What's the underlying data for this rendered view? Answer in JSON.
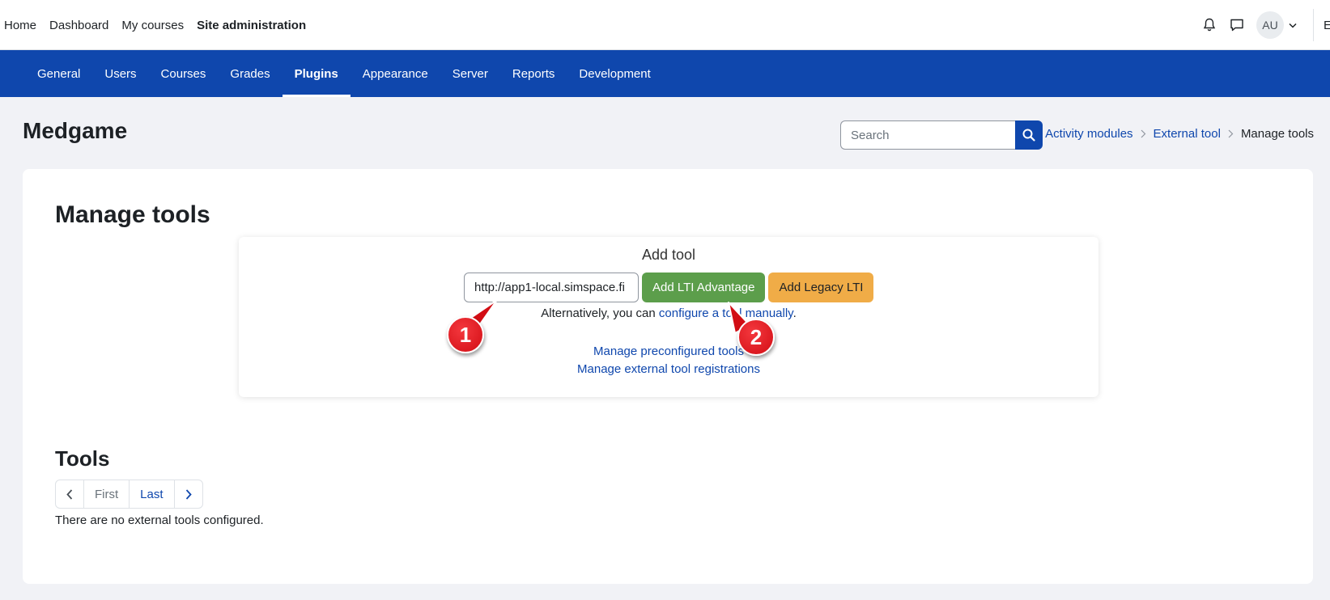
{
  "topnav": {
    "items": [
      {
        "label": "Home"
      },
      {
        "label": "Dashboard"
      },
      {
        "label": "My courses"
      },
      {
        "label": "Site administration"
      }
    ],
    "avatar_initials": "AU",
    "edge_letter": "E"
  },
  "secondary_nav": {
    "items": [
      {
        "label": "General"
      },
      {
        "label": "Users"
      },
      {
        "label": "Courses"
      },
      {
        "label": "Grades"
      },
      {
        "label": "Plugins",
        "active": true
      },
      {
        "label": "Appearance"
      },
      {
        "label": "Server"
      },
      {
        "label": "Reports"
      },
      {
        "label": "Development"
      }
    ]
  },
  "header": {
    "site_name": "Medgame",
    "search_placeholder": "Search",
    "breadcrumb": [
      "Activity modules",
      "External tool",
      "Manage tools"
    ]
  },
  "main": {
    "title": "Manage tools",
    "add_tool": {
      "title": "Add tool",
      "url_value": "http://app1-local.simspace.fi",
      "add_lti_advantage": "Add LTI Advantage",
      "add_legacy_lti": "Add Legacy LTI",
      "alt_prefix": "Alternatively, you can ",
      "alt_link": "configure a tool manually",
      "alt_suffix": ".",
      "manage_preconfigured": "Manage preconfigured tools",
      "manage_registrations": "Manage external tool registrations"
    },
    "tools": {
      "title": "Tools",
      "pager_first": "First",
      "pager_last": "Last",
      "empty_message": "There are no external tools configured."
    }
  },
  "annotations": [
    {
      "number": "1"
    },
    {
      "number": "2"
    }
  ],
  "colors": {
    "primary": "#0f47ad",
    "success": "#5c9e4b",
    "warning": "#f0ac47",
    "callout": "#e0141b"
  }
}
